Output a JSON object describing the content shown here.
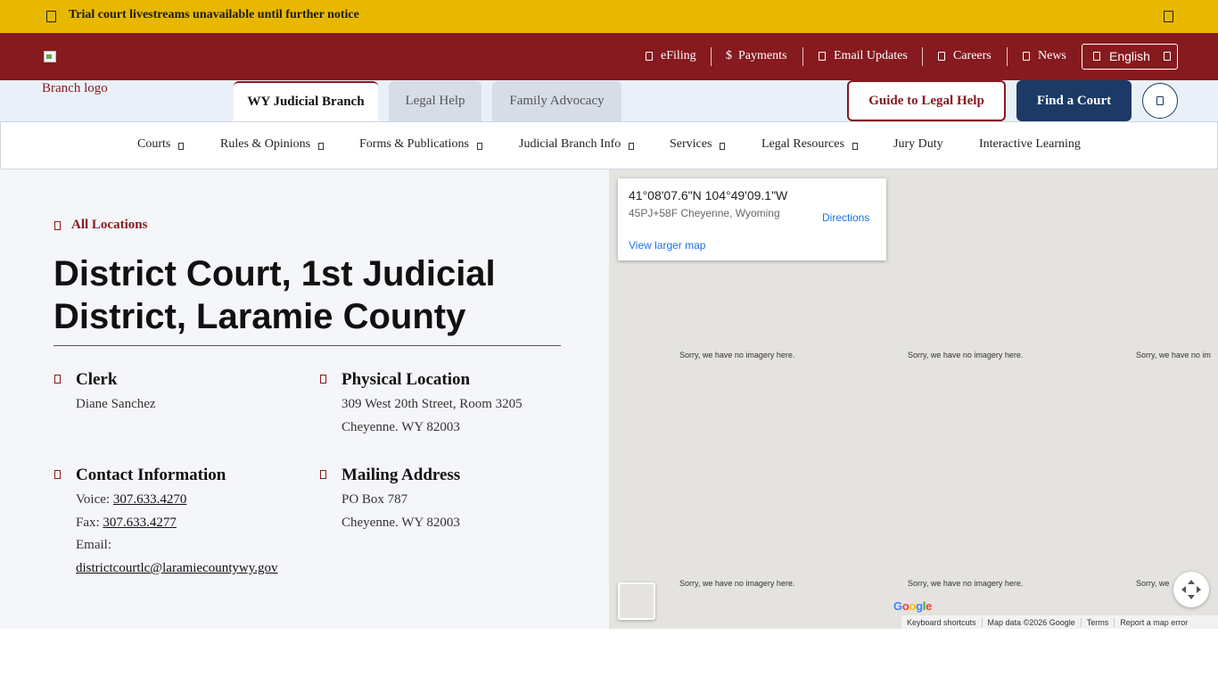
{
  "alert": {
    "text": "Trial court livestreams unavailable until further notice",
    "icon": "calendar-icon",
    "close_icon": "close-icon"
  },
  "topbar": {
    "logo_alt": "Branch logo",
    "links": [
      {
        "label": "eFiling",
        "icon": "file-icon"
      },
      {
        "label": "Payments",
        "icon": "dollar-icon"
      },
      {
        "label": "Email Updates",
        "icon": "envelope-icon"
      },
      {
        "label": "Careers",
        "icon": "briefcase-icon"
      },
      {
        "label": "News",
        "icon": "newspaper-icon"
      }
    ],
    "payments_symbol": "$",
    "language": "English"
  },
  "tabs": [
    {
      "label": "WY Judicial Branch",
      "active": true
    },
    {
      "label": "Legal Help",
      "active": false
    },
    {
      "label": "Family Advocacy",
      "active": false
    }
  ],
  "actions": {
    "guide": "Guide to Legal Help",
    "find": "Find a Court",
    "search_icon": "search-icon"
  },
  "nav": {
    "items": [
      "Courts",
      "Rules & Opinions",
      "Forms & Publications",
      "Judicial Branch Info",
      "Services",
      "Legal Resources",
      "Jury Duty",
      "Interactive Learning"
    ]
  },
  "page": {
    "back_link": "All Locations",
    "title": "District Court, 1st Judicial District, Laramie County",
    "clerk": {
      "heading": "Clerk",
      "name": "Diane Sanchez"
    },
    "physical": {
      "heading": "Physical Location",
      "line1": "309 West 20th Street, Room 3205",
      "line2": "Cheyenne. WY 82003"
    },
    "contact": {
      "heading": "Contact Information",
      "voice_label": "Voice:",
      "voice": "307.633.4270",
      "fax_label": "Fax:",
      "fax": "307.633.4277",
      "email_label": "Email:",
      "email": "districtcourtlc@laramiecountywy.gov"
    },
    "mailing": {
      "heading": "Mailing Address",
      "line1": "PO Box 787",
      "line2": "Cheyenne. WY 82003"
    }
  },
  "map": {
    "coords": "41°08'07.6\"N 104°49'09.1\"W",
    "plus_code": "45PJ+58F Cheyenne, Wyoming",
    "directions": "Directions",
    "larger_map": "View larger map",
    "no_imagery": "Sorry, we have no imagery here.",
    "no_imagery_cut": "Sorry, we have no im",
    "no_imagery_cut2": "Sorry, we",
    "google": "Google",
    "attribution": [
      "Keyboard shortcuts",
      "Map data ©2026 Google",
      "Terms",
      "Report a map error"
    ],
    "colors": {
      "blue": "#4285F4",
      "red": "#EA4335",
      "yellow": "#FBBC05",
      "green": "#34A853"
    }
  },
  "colors": {
    "alert_bg": "#e8b800",
    "brand_red": "#861a1f",
    "brand_navy": "#1b3a66",
    "panel_bg": "#f4f6f9"
  }
}
